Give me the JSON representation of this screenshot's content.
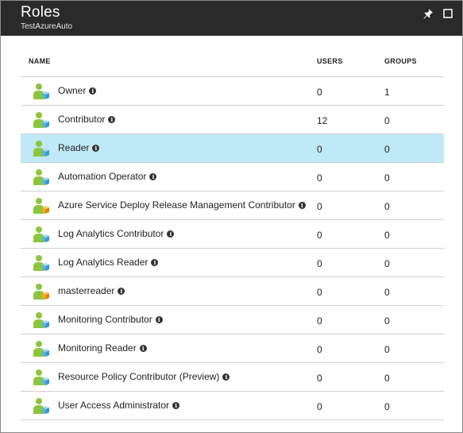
{
  "blade": {
    "title": "Roles",
    "subtitle": "TestAzureAuto",
    "pin_icon": "pin-icon",
    "maximize_icon": "maximize-icon"
  },
  "table": {
    "columns": {
      "name": "NAME",
      "users": "USERS",
      "groups": "GROUPS"
    },
    "selected_index": 2,
    "rows": [
      {
        "name": "Owner",
        "users": "0",
        "groups": "1",
        "icon": "built-in"
      },
      {
        "name": "Contributor",
        "users": "12",
        "groups": "0",
        "icon": "built-in"
      },
      {
        "name": "Reader",
        "users": "0",
        "groups": "0",
        "icon": "built-in"
      },
      {
        "name": "Automation Operator",
        "users": "0",
        "groups": "0",
        "icon": "built-in"
      },
      {
        "name": "Azure Service Deploy Release Management Contributor",
        "users": "0",
        "groups": "0",
        "icon": "custom"
      },
      {
        "name": "Log Analytics Contributor",
        "users": "0",
        "groups": "0",
        "icon": "built-in"
      },
      {
        "name": "Log Analytics Reader",
        "users": "0",
        "groups": "0",
        "icon": "built-in"
      },
      {
        "name": "masterreader",
        "users": "0",
        "groups": "0",
        "icon": "custom"
      },
      {
        "name": "Monitoring Contributor",
        "users": "0",
        "groups": "0",
        "icon": "built-in"
      },
      {
        "name": "Monitoring Reader",
        "users": "0",
        "groups": "0",
        "icon": "built-in"
      },
      {
        "name": "Resource Policy Contributor (Preview)",
        "users": "0",
        "groups": "0",
        "icon": "built-in"
      },
      {
        "name": "User Access Administrator",
        "users": "0",
        "groups": "0",
        "icon": "built-in"
      }
    ]
  },
  "colors": {
    "header_bg": "#2a2a2a",
    "selected_row_bg": "#bfe9f6",
    "role_person": "#8cc63f",
    "role_cube_builtin": "#59b4d9",
    "role_cube_custom": "#f5a623"
  }
}
